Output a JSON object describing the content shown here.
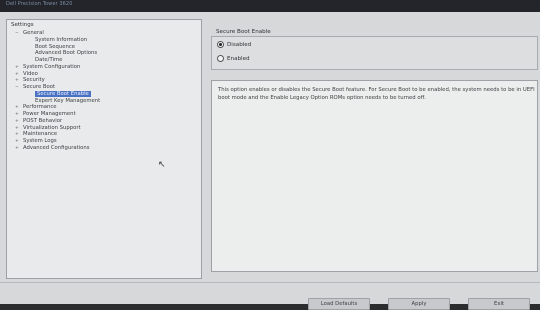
{
  "window": {
    "title": "Dell Precision Tower 3620"
  },
  "left_panel": {
    "heading": "Settings",
    "tree": [
      {
        "label": "General",
        "level": 0,
        "expander": "−"
      },
      {
        "label": "System Information",
        "level": 1
      },
      {
        "label": "Boot Sequence",
        "level": 1
      },
      {
        "label": "Advanced Boot Options",
        "level": 1
      },
      {
        "label": "Date/Time",
        "level": 1
      },
      {
        "label": "System Configuration",
        "level": 0,
        "expander": "+"
      },
      {
        "label": "Video",
        "level": 0,
        "expander": "+"
      },
      {
        "label": "Security",
        "level": 0,
        "expander": "+"
      },
      {
        "label": "Secure Boot",
        "level": 0,
        "expander": "−"
      },
      {
        "label": "Secure Boot Enable",
        "level": 1,
        "selected": true
      },
      {
        "label": "Expert Key Management",
        "level": 1
      },
      {
        "label": "Performance",
        "level": 0,
        "expander": "+"
      },
      {
        "label": "Power Management",
        "level": 0,
        "expander": "+"
      },
      {
        "label": "POST Behavior",
        "level": 0,
        "expander": "+"
      },
      {
        "label": "Virtualization Support",
        "level": 0,
        "expander": "+"
      },
      {
        "label": "Maintenance",
        "level": 0,
        "expander": "+"
      },
      {
        "label": "System Logs",
        "level": 0,
        "expander": "+"
      },
      {
        "label": "Advanced Configurations",
        "level": 0,
        "expander": "+"
      }
    ]
  },
  "secure_boot": {
    "group_title": "Secure Boot Enable",
    "options": [
      {
        "label": "Disabled",
        "checked": true
      },
      {
        "label": "Enabled",
        "checked": false
      }
    ]
  },
  "description": "This option enables or disables the Secure Boot feature. For Secure Boot to be enabled, the system needs to be in UEFI boot mode and the Enable Legacy Option ROMs option needs to be turned off.",
  "buttons": {
    "load_defaults": "Load Defaults",
    "apply": "Apply",
    "exit": "Exit"
  }
}
